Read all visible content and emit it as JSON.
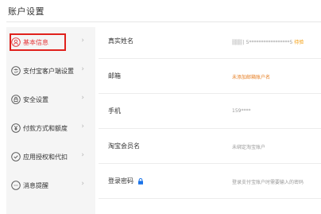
{
  "page": {
    "title": "账户设置"
  },
  "sidebar": {
    "items": [
      {
        "label": "基本信息",
        "icon": "user-icon",
        "active": true
      },
      {
        "label": "支付宝客户端设置",
        "icon": "alipay-icon"
      },
      {
        "label": "安全设置",
        "icon": "lock-icon"
      },
      {
        "label": "付款方式和额度",
        "icon": "yen-icon"
      },
      {
        "label": "应用授权和代扣",
        "icon": "check-circle-icon"
      },
      {
        "label": "消息提醒",
        "icon": "chat-icon"
      }
    ],
    "chevron": "›"
  },
  "profile": {
    "rows": [
      {
        "key": "真实姓名",
        "value_masked": "| 5*****************5",
        "value_link": "待验"
      },
      {
        "key": "邮箱",
        "value": "未添加邮箱账户名"
      },
      {
        "key": "手机",
        "value": "159****"
      },
      {
        "key": "淘宝会员名",
        "value": "未绑定淘宝账户"
      },
      {
        "key": "登录密码",
        "value": "登录支付宝账户时需要输入的密码",
        "key_icon": "lock-icon"
      }
    ]
  },
  "colors": {
    "accent": "#e4393c",
    "warn": "#e67e22",
    "link": "#f39800"
  }
}
